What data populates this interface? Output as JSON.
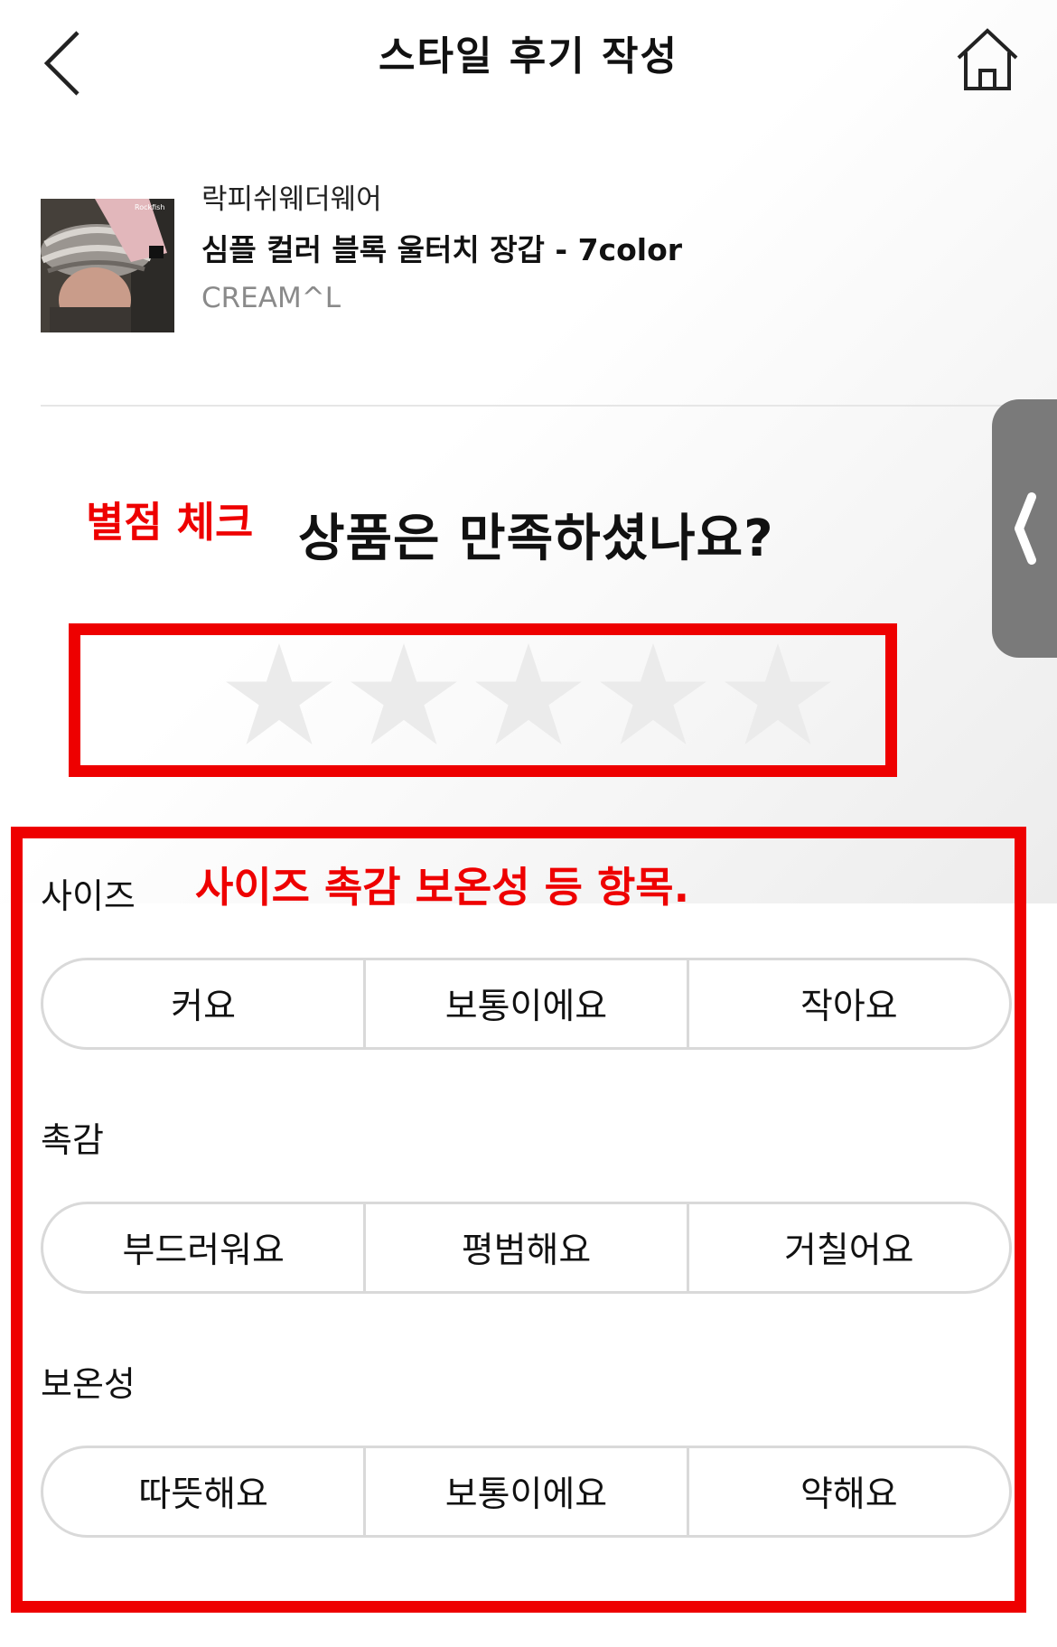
{
  "header": {
    "title": "스타일 후기 작성",
    "back_icon": "chevron-left-icon",
    "home_icon": "home-icon"
  },
  "product": {
    "brand": "락피쉬웨더웨어",
    "name": "심플 컬러 블록 울터치 장갑 - 7color",
    "option": "CREAM^L"
  },
  "rating": {
    "annotation": "별점 체크",
    "question": "상품은 만족하셨나요?",
    "max_stars": 5,
    "selected_stars": 0
  },
  "attributes": {
    "annotation": "사이즈 촉감 보온성 등 항목.",
    "groups": [
      {
        "label": "사이즈",
        "options": [
          "커요",
          "보통이에요",
          "작아요"
        ]
      },
      {
        "label": "촉감",
        "options": [
          "부드러워요",
          "평범해요",
          "거칠어요"
        ]
      },
      {
        "label": "보온성",
        "options": [
          "따뜻해요",
          "보통이에요",
          "약해요"
        ]
      }
    ]
  },
  "colors": {
    "annotation_red": "#ee0000",
    "star_empty": "#ebebeb",
    "side_tab": "#7a7a7a"
  }
}
